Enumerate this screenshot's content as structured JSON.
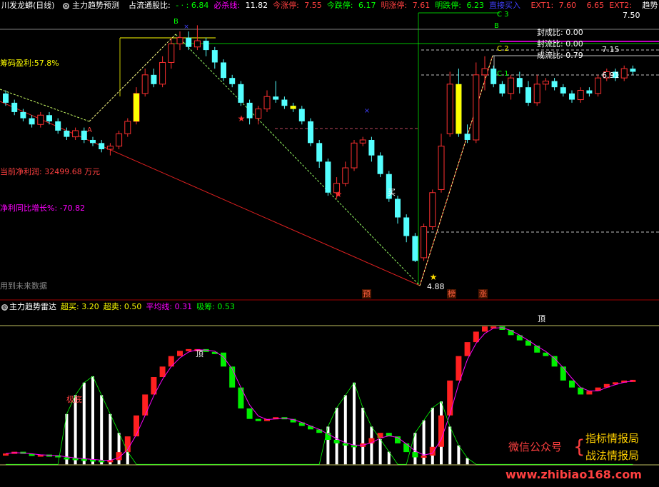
{
  "header": {
    "title": "川发龙蟒(日线)",
    "indicator": "主力趋势预测",
    "items": [
      {
        "label": "占流通股比:",
        "value": "- · : 6.84",
        "label_color": "#ffffff",
        "value_color": "#00ff00"
      },
      {
        "label": "必杀线:",
        "value": "11.82",
        "label_color": "#ff00ff",
        "value_color": "#ffffff"
      },
      {
        "label": "今涨停:",
        "value": "7.55",
        "label_color": "#ff4040",
        "value_color": "#ff4040"
      },
      {
        "label": "今跌停:",
        "value": "6.17",
        "label_color": "#00ff00",
        "value_color": "#00ff00"
      },
      {
        "label": "明涨停:",
        "value": "7.61",
        "label_color": "#ff4040",
        "value_color": "#ff4040"
      },
      {
        "label": "明跌停:",
        "value": "6.23",
        "label_color": "#00ff00",
        "value_color": "#00ff00"
      },
      {
        "label": "直接买入",
        "value": "",
        "label_color": "#4040ff",
        "value_color": "#4040ff"
      },
      {
        "label": "EXT1:",
        "value": "7.60",
        "label_color": "#ff4040",
        "value_color": "#ff4040"
      },
      {
        "label": "",
        "value": "6.65",
        "label_color": "#ff4040",
        "value_color": "#ff4040"
      },
      {
        "label": "EXT2:",
        "value": "",
        "label_color": "#ff4040",
        "value_color": "#ff4040"
      },
      {
        "label": "趋势",
        "value": "",
        "label_color": "#ffffff",
        "value_color": "#ffffff"
      }
    ],
    "price_right": "7.50"
  },
  "main_panel": {
    "chip_profit": "筹码盈利:57.8%",
    "net_profit": "当前净利润: 32499.68 万元",
    "profit_growth": "净利同比增长%: -70.82",
    "future_data": "用到未来数据",
    "seal_ratio": "封成比: 0.00",
    "seal_flow_ratio": "封流比: 0.00",
    "deal_flow_ratio": "成流比: 0.79",
    "level_715": "7.15",
    "level_691": "6.91",
    "low_price": "4.88",
    "buy_label": "买",
    "letters": [
      "A",
      "B",
      "B",
      "C 2",
      "C 1",
      "C 3"
    ],
    "markers": [
      "预",
      "榜",
      "涨"
    ]
  },
  "sub_panel": {
    "title": "主力趋势雷达",
    "items": [
      {
        "label": "超买:",
        "value": "3.20",
        "color": "#ffff00"
      },
      {
        "label": "超卖:",
        "value": "0.50",
        "color": "#ffff00"
      },
      {
        "label": "平均线:",
        "value": "0.31",
        "color": "#ff00ff"
      },
      {
        "label": "吸筹:",
        "value": "0.53",
        "color": "#00ff00"
      }
    ],
    "bottom_label": "极底",
    "top_label1": "顶",
    "top_label2": "顶"
  },
  "watermark": {
    "wechat": "微信公众号",
    "line1": "指标情报局",
    "line2": "战法情报局",
    "url": "www.zhibiao168.com"
  },
  "chart_data": {
    "type": "candlestick",
    "candles": [
      [
        7.6,
        7.45,
        7.65,
        7.4
      ],
      [
        7.45,
        7.3,
        7.5,
        7.25
      ],
      [
        7.3,
        7.2,
        7.35,
        7.15
      ],
      [
        7.2,
        7.1,
        7.25,
        7.05
      ],
      [
        7.1,
        7.25,
        7.3,
        7.05
      ],
      [
        7.25,
        7.15,
        7.3,
        7.1
      ],
      [
        7.15,
        7.0,
        7.2,
        6.95
      ],
      [
        7.0,
        6.9,
        7.05,
        6.85
      ],
      [
        6.9,
        7.0,
        7.05,
        6.85
      ],
      [
        7.0,
        6.85,
        7.05,
        6.8
      ],
      [
        6.85,
        6.8,
        6.9,
        6.75
      ],
      [
        6.8,
        6.7,
        6.85,
        6.65
      ],
      [
        6.7,
        6.75,
        6.8,
        6.6
      ],
      [
        6.75,
        6.95,
        7.0,
        6.7
      ],
      [
        6.95,
        7.15,
        7.2,
        6.9
      ],
      [
        7.15,
        7.6,
        7.7,
        7.1
      ],
      [
        7.6,
        7.9,
        8.0,
        7.55
      ],
      [
        7.9,
        7.75,
        8.0,
        7.7
      ],
      [
        7.75,
        8.1,
        8.2,
        7.7
      ],
      [
        8.1,
        8.4,
        8.5,
        8.0
      ],
      [
        8.4,
        8.5,
        8.6,
        8.3
      ],
      [
        8.5,
        8.35,
        8.6,
        8.3
      ],
      [
        8.35,
        8.45,
        8.7,
        8.3
      ],
      [
        8.45,
        8.3,
        8.5,
        8.2
      ],
      [
        8.3,
        8.1,
        8.35,
        8.0
      ],
      [
        8.1,
        7.85,
        8.15,
        7.8
      ],
      [
        7.85,
        7.75,
        7.9,
        7.7
      ],
      [
        7.75,
        7.45,
        7.8,
        7.4
      ],
      [
        7.45,
        7.2,
        7.5,
        7.1
      ],
      [
        7.2,
        7.35,
        7.4,
        7.1
      ],
      [
        7.35,
        7.55,
        7.65,
        7.3
      ],
      [
        7.55,
        7.5,
        7.8,
        7.45
      ],
      [
        7.5,
        7.4,
        7.55,
        7.35
      ],
      [
        7.4,
        7.35,
        7.45,
        7.3
      ],
      [
        7.35,
        7.15,
        7.4,
        7.1
      ],
      [
        7.15,
        6.8,
        7.2,
        6.75
      ],
      [
        6.8,
        6.5,
        6.85,
        6.4
      ],
      [
        6.5,
        6.0,
        6.55,
        5.95
      ],
      [
        6.0,
        6.15,
        6.25,
        5.9
      ],
      [
        6.15,
        6.4,
        6.5,
        6.1
      ],
      [
        6.4,
        6.8,
        6.85,
        6.35
      ],
      [
        6.8,
        6.85,
        6.9,
        6.75
      ],
      [
        6.85,
        6.6,
        6.9,
        6.5
      ],
      [
        6.6,
        6.3,
        6.65,
        6.25
      ],
      [
        6.3,
        5.9,
        6.35,
        5.85
      ],
      [
        5.9,
        5.6,
        5.95,
        5.5
      ],
      [
        5.6,
        5.3,
        5.65,
        5.2
      ],
      [
        5.3,
        4.9,
        5.35,
        4.88
      ],
      [
        4.95,
        5.45,
        5.5,
        4.9
      ],
      [
        5.45,
        6.0,
        6.05,
        5.4
      ],
      [
        6.05,
        6.75,
        6.95,
        6.0
      ],
      [
        6.95,
        7.75,
        7.95,
        6.9
      ],
      [
        7.75,
        6.95,
        8.0,
        6.9
      ],
      [
        6.95,
        6.85,
        7.1,
        6.8
      ],
      [
        6.85,
        7.9,
        8.1,
        6.8
      ],
      [
        7.9,
        8.0,
        8.2,
        7.65
      ],
      [
        8.0,
        7.75,
        8.05,
        7.7
      ],
      [
        7.75,
        7.6,
        7.8,
        7.55
      ],
      [
        7.6,
        7.85,
        7.9,
        7.5
      ],
      [
        7.85,
        7.7,
        7.95,
        7.6
      ],
      [
        7.7,
        7.45,
        7.8,
        7.4
      ],
      [
        7.45,
        7.75,
        7.9,
        7.4
      ],
      [
        7.75,
        7.8,
        7.85,
        7.65
      ],
      [
        7.8,
        7.7,
        7.85,
        7.65
      ],
      [
        7.7,
        7.6,
        7.75,
        7.55
      ],
      [
        7.6,
        7.5,
        7.65,
        7.45
      ],
      [
        7.5,
        7.65,
        7.7,
        7.45
      ],
      [
        7.65,
        7.6,
        7.7,
        7.55
      ],
      [
        7.6,
        7.85,
        7.9,
        7.55
      ],
      [
        7.85,
        7.95,
        8.0,
        7.8
      ],
      [
        7.95,
        7.85,
        8.0,
        7.8
      ],
      [
        7.85,
        8.0,
        8.05,
        7.8
      ],
      [
        8.0,
        7.95,
        8.05,
        7.9
      ]
    ],
    "radar": [
      0.31,
      0.36,
      0.3,
      0.24,
      0.28,
      0.26,
      0.2,
      0.18,
      0.16,
      0.14,
      0.12,
      0.1,
      0.12,
      0.35,
      0.8,
      1.4,
      2.0,
      2.5,
      2.8,
      3.1,
      3.25,
      3.3,
      3.3,
      3.22,
      3.2,
      2.8,
      2.2,
      1.6,
      1.3,
      1.25,
      1.3,
      1.35,
      1.3,
      1.2,
      1.1,
      1.0,
      0.9,
      0.7,
      0.6,
      0.55,
      0.5,
      0.6,
      0.75,
      0.9,
      0.8,
      0.6,
      0.35,
      0.2,
      0.25,
      0.5,
      1.4,
      2.4,
      3.1,
      3.5,
      3.8,
      3.95,
      3.95,
      3.85,
      3.7,
      3.55,
      3.4,
      3.2,
      3.1,
      2.8,
      2.4,
      2.2,
      2.0,
      2.1,
      2.2,
      2.3,
      2.35,
      2.4,
      2.42
    ],
    "xishou": [
      0,
      0,
      0,
      0,
      0,
      0,
      0,
      0.8,
      1.1,
      1.3,
      1.4,
      1.1,
      0.8,
      0.5,
      0.2,
      0,
      0,
      0,
      0,
      0,
      0,
      0,
      0,
      0,
      0,
      0,
      0,
      0,
      0,
      0,
      0,
      0,
      0,
      0,
      0,
      0,
      0,
      0.6,
      0.9,
      1.1,
      1.3,
      0.9,
      0.6,
      0.4,
      0.2,
      0,
      0,
      0.5,
      0.7,
      0.9,
      1.0,
      0.6,
      0.3,
      0.1,
      0,
      0,
      0,
      0,
      0,
      0,
      0,
      0,
      0,
      0,
      0,
      0,
      0,
      0,
      0,
      0,
      0,
      0,
      0
    ],
    "ylim_main": [
      4.5,
      8.9
    ],
    "ylim_sub": [
      -0.2,
      4.3
    ]
  }
}
